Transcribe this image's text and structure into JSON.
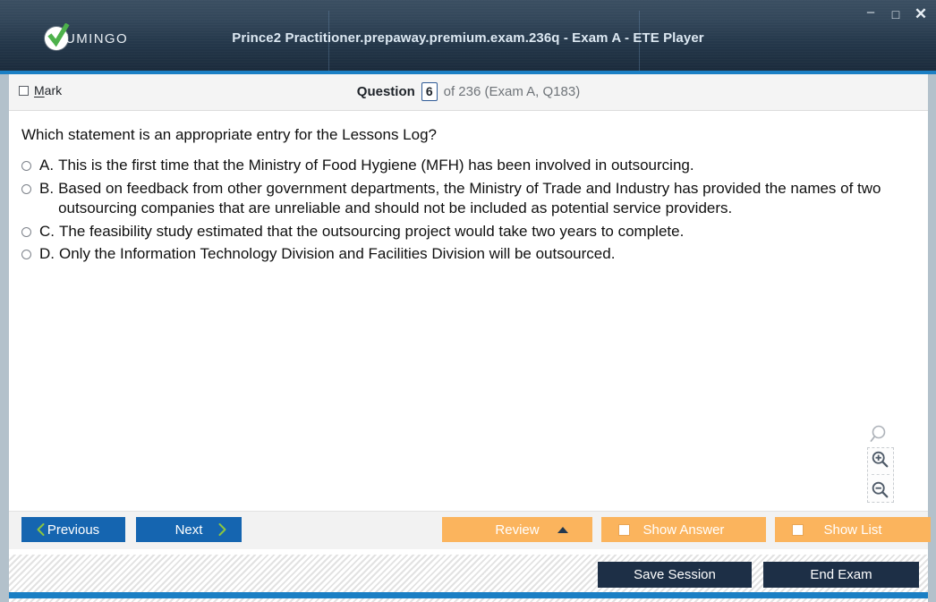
{
  "window": {
    "title": "Prince2 Practitioner.prepaway.premium.exam.236q - Exam A - ETE Player",
    "logo_text": "UMINGO",
    "controls": {
      "minimize": "–",
      "maximize": "□",
      "close": "✕"
    },
    "accent_color": "#1b7fc4",
    "titlebar_color": "#24374a"
  },
  "question_header": {
    "mark_label": "Mark",
    "mark_accelerator": "M",
    "mark_checked": false,
    "question_label": "Question",
    "question_number": "6",
    "question_rest": "of 236 (Exam A, Q183)",
    "total_questions": "236",
    "exam_section": "Exam A",
    "source_question_id": "Q183"
  },
  "question": {
    "text": "Which statement is an appropriate entry for the Lessons Log?",
    "options": [
      {
        "letter": "A.",
        "text": "This is the first time that the Ministry of Food Hygiene (MFH) has been involved in outsourcing.",
        "selected": false
      },
      {
        "letter": "B.",
        "text": "Based on feedback from other government departments, the Ministry of Trade and Industry has provided the names of two outsourcing companies that are unreliable and should not be included as potential service providers.",
        "selected": false
      },
      {
        "letter": "C.",
        "text": "The feasibility study estimated that the outsourcing project would take two years to complete.",
        "selected": false
      },
      {
        "letter": "D.",
        "text": "Only the Information Technology Division and Facilities Division will be outsourced.",
        "selected": false
      }
    ]
  },
  "zoom_controls": {
    "magnifier_icon": "magnifier-icon",
    "zoom_in_icon": "zoom-in-icon",
    "zoom_out_icon": "zoom-out-icon"
  },
  "toolbar": {
    "previous_label": "Previous",
    "next_label": "Next",
    "review_label": "Review",
    "show_answer_label": "Show Answer",
    "show_list_label": "Show List",
    "blue_color": "#1565b0",
    "orange_color": "#fbb45d"
  },
  "footer": {
    "save_session_label": "Save Session",
    "end_exam_label": "End Exam"
  }
}
